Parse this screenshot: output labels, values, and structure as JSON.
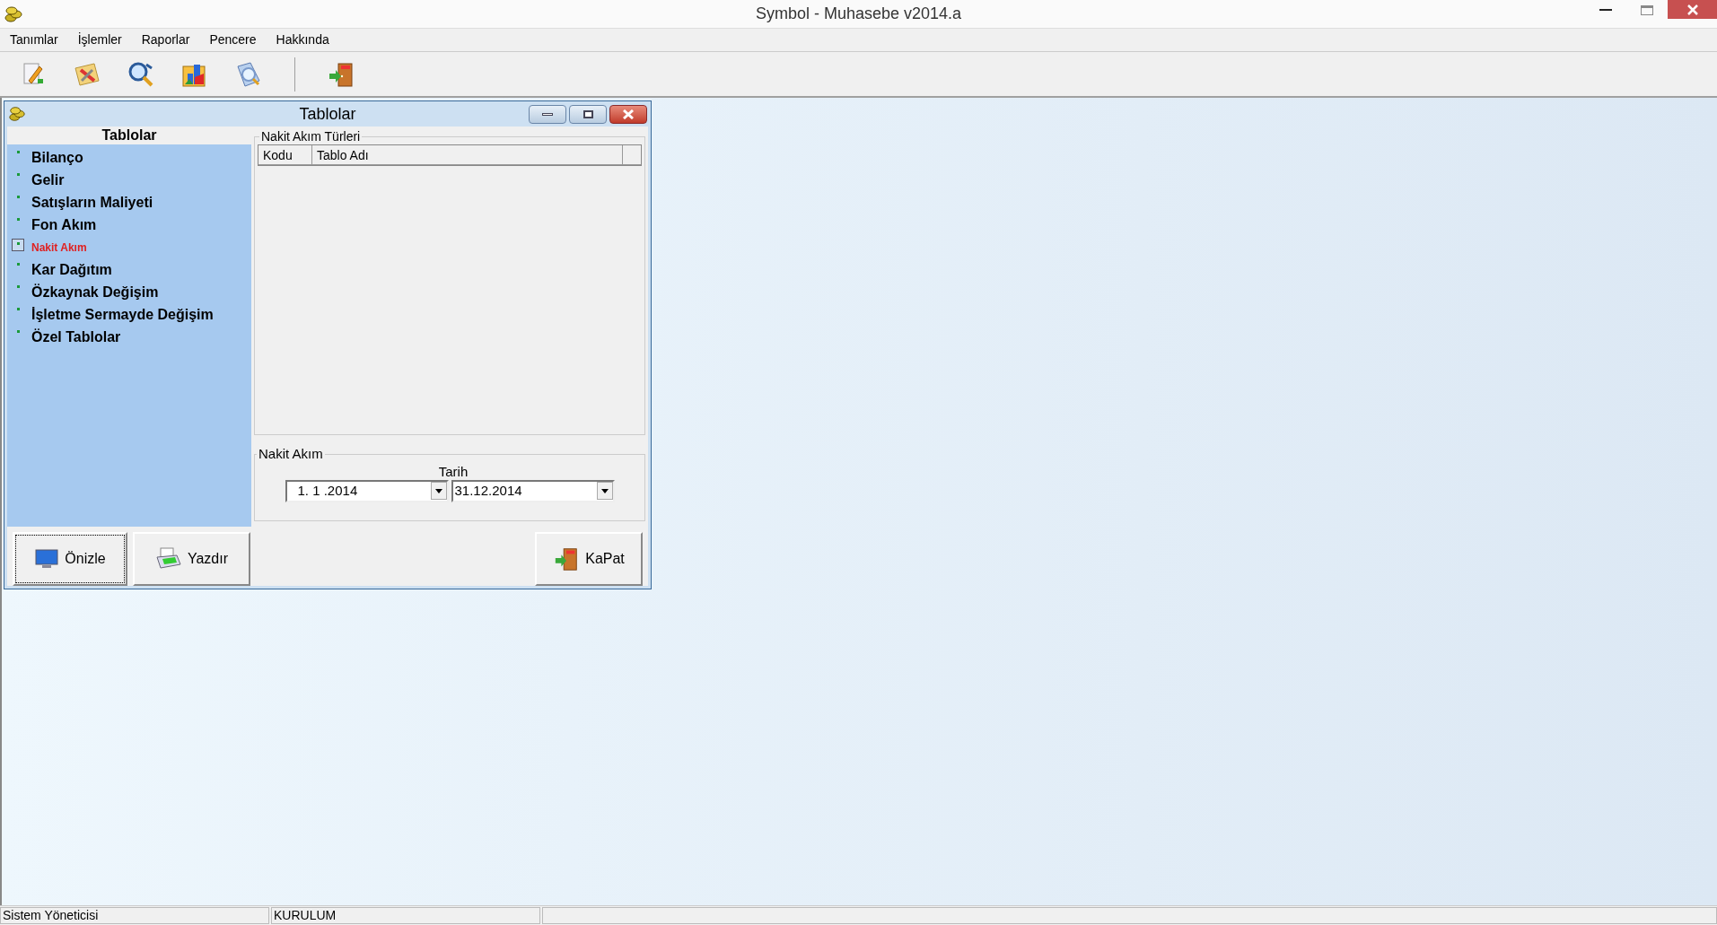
{
  "window": {
    "title": "Symbol - Muhasebe v2014.a"
  },
  "menu": [
    "Tanımlar",
    "İşlemler",
    "Raporlar",
    "Pencere",
    "Hakkında"
  ],
  "toolbar": [
    {
      "kind": "edit"
    },
    {
      "kind": "tools"
    },
    {
      "kind": "search"
    },
    {
      "kind": "chart"
    },
    {
      "kind": "find"
    },
    {
      "kind": "separator"
    },
    {
      "kind": "exit"
    }
  ],
  "child_window": {
    "title": "Tablolar",
    "sidebar": {
      "title": "Tablolar",
      "items": [
        {
          "label": "Bilanço",
          "selected": false
        },
        {
          "label": "Gelir",
          "selected": false
        },
        {
          "label": "Satışların Maliyeti",
          "selected": false
        },
        {
          "label": "Fon Akım",
          "selected": false
        },
        {
          "label": "Nakit Akım",
          "selected": true
        },
        {
          "label": "Kar Dağıtım",
          "selected": false
        },
        {
          "label": "Özkaynak Değişim",
          "selected": false
        },
        {
          "label": "İşletme Sermayde Değişim",
          "selected": false
        },
        {
          "label": "Özel Tablolar",
          "selected": false
        }
      ]
    },
    "types_group": {
      "title": "Nakit Akım Türleri",
      "columns": [
        "Kodu",
        "Tablo Adı"
      ]
    },
    "date_group": {
      "title": "Nakit Akım",
      "label": "Tarih",
      "from": "1. 1 .2014",
      "to": "31.12.2014"
    },
    "buttons": [
      {
        "kind": "preview",
        "label": "Önizle"
      },
      {
        "kind": "print",
        "label": "Yazdır"
      },
      {
        "kind": "close",
        "label": "KaPat"
      }
    ]
  },
  "status_bar": [
    "Sistem Yöneticisi",
    "KURULUM"
  ]
}
